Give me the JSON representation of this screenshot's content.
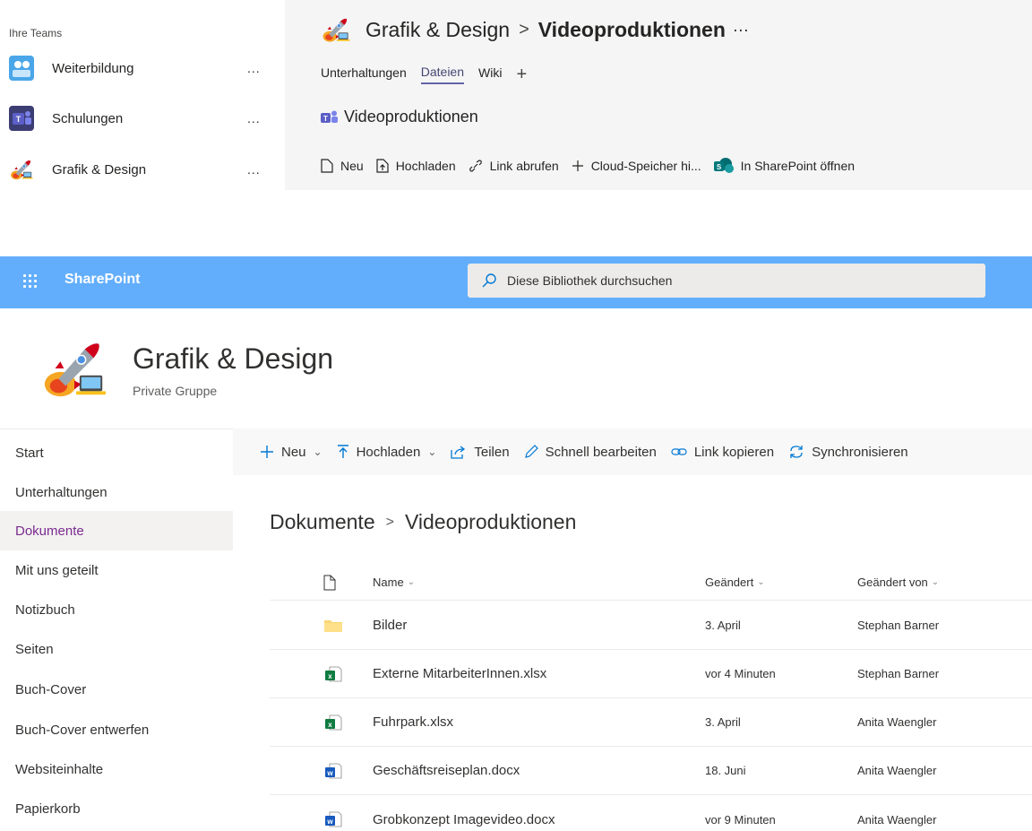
{
  "teams": {
    "heading": "Ihre Teams",
    "items": [
      {
        "name": "Weiterbildung",
        "more": "...",
        "icon": "training-icon"
      },
      {
        "name": "Schulungen",
        "more": "...",
        "icon": "teams-logo-icon"
      },
      {
        "name": "Grafik & Design",
        "more": "...",
        "icon": "rocket-icon"
      }
    ]
  },
  "channel": {
    "team": "Grafik & Design",
    "separator": ">",
    "name": "Videoproduktionen",
    "more": "···",
    "tabs": [
      "Unterhaltungen",
      "Dateien",
      "Wiki"
    ],
    "active_tab": "Dateien",
    "add_tab": "+",
    "files_title": "Videoproduktionen",
    "commands": {
      "new": "Neu",
      "upload": "Hochladen",
      "get_link": "Link abrufen",
      "cloud": "Cloud-Speicher hi...",
      "open_sp": "In SharePoint öffnen"
    }
  },
  "suitebar": {
    "app_name": "SharePoint",
    "search_placeholder": "Diese Bibliothek durchsuchen",
    "color": "#62aefc"
  },
  "site": {
    "title": "Grafik & Design",
    "subtitle": "Private Gruppe"
  },
  "nav": {
    "items": [
      "Start",
      "Unterhaltungen",
      "Dokumente",
      "Mit uns geteilt",
      "Notizbuch",
      "Seiten",
      "Buch-Cover",
      "Buch-Cover entwerfen",
      "Websiteinhalte",
      "Papierkorb"
    ],
    "selected": "Dokumente",
    "selected_color": "#7a2b8e"
  },
  "commandbar": {
    "new": "Neu",
    "upload": "Hochladen",
    "share": "Teilen",
    "quick_edit": "Schnell bearbeiten",
    "copy_link": "Link kopieren",
    "sync": "Synchronisieren"
  },
  "breadcrumb": {
    "root": "Dokumente",
    "separator": ">",
    "current": "Videoproduktionen"
  },
  "list": {
    "columns": {
      "name": "Name",
      "modified": "Geändert",
      "modified_by": "Geändert von"
    },
    "rows": [
      {
        "type": "folder",
        "name": "Bilder",
        "modified": "3. April",
        "modified_by": "Stephan Barner"
      },
      {
        "type": "excel",
        "name": "Externe MitarbeiterInnen.xlsx",
        "modified": "vor 4 Minuten",
        "modified_by": "Stephan Barner"
      },
      {
        "type": "excel",
        "name": "Fuhrpark.xlsx",
        "modified": "3. April",
        "modified_by": "Anita Waengler"
      },
      {
        "type": "word",
        "name": "Geschäftsreiseplan.docx",
        "modified": "18. Juni",
        "modified_by": "Anita Waengler"
      },
      {
        "type": "word",
        "name": "Grobkonzept Imagevideo.docx",
        "modified": "vor 9 Minuten",
        "modified_by": "Anita Waengler"
      }
    ]
  }
}
